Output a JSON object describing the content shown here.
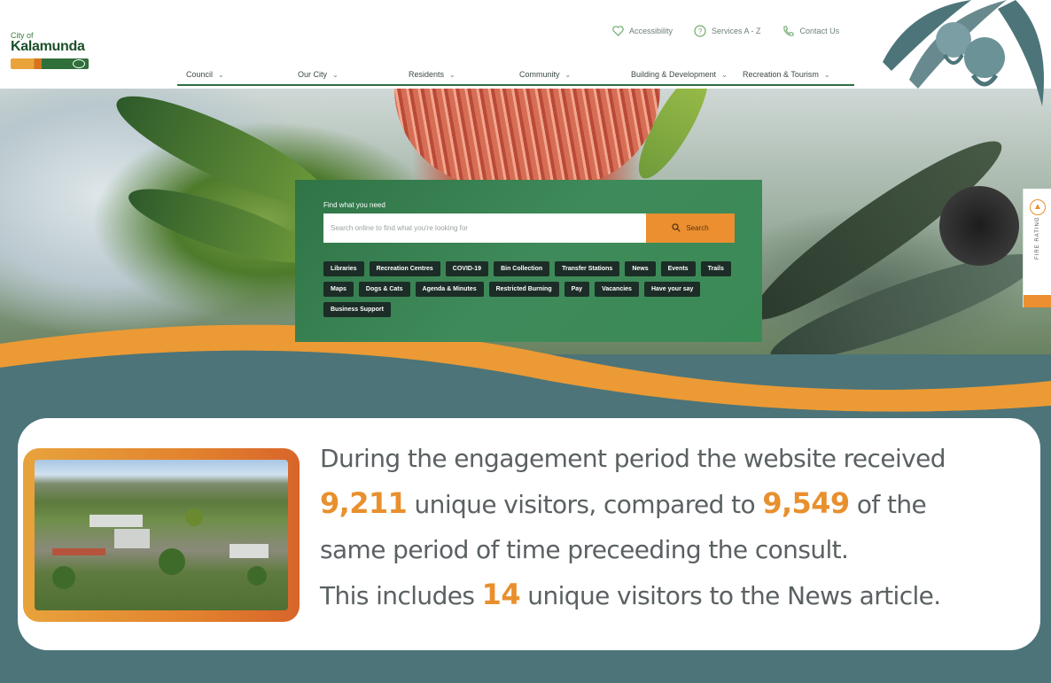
{
  "header": {
    "logo": {
      "line1": "City of",
      "line2": "Kalamunda"
    },
    "utility": [
      {
        "label": "Accessibility",
        "icon": "heart-icon"
      },
      {
        "label": "Services A - Z",
        "icon": "question-icon"
      },
      {
        "label": "Contact Us",
        "icon": "phone-icon"
      }
    ],
    "nav": [
      {
        "label": "Council"
      },
      {
        "label": "Our City"
      },
      {
        "label": "Residents"
      },
      {
        "label": "Community"
      },
      {
        "label": "Building & Development"
      },
      {
        "label": "Recreation & Tourism"
      }
    ]
  },
  "search": {
    "heading": "Find what you need",
    "placeholder": "Search online to find what you're looking for",
    "button_label": "Search",
    "quick_links": [
      "Libraries",
      "Recreation Centres",
      "COVID-19",
      "Bin Collection",
      "Transfer Stations",
      "News",
      "Events",
      "Trails",
      "Maps",
      "Dogs & Cats",
      "Agenda & Minutes",
      "Restricted Burning",
      "Pay",
      "Vacancies",
      "Have your say",
      "Business Support"
    ]
  },
  "fire_tab": {
    "label": "FIRE RATING"
  },
  "info": {
    "line1": "During the engagement period the website received",
    "line2_num1": "9,211",
    "line2_mid": " unique visitors, compared to ",
    "line2_num2": "9,549",
    "line2_end": " of the",
    "line3": "same period of time preceeding the consult.",
    "line4_start": "This includes ",
    "line4_num": "14",
    "line4_end": " unique visitors to the News article."
  },
  "colors": {
    "accent_orange": "#e8902e",
    "brand_green": "#2f7446",
    "teal": "#4d7479",
    "dark_chip": "#1b2d26"
  }
}
